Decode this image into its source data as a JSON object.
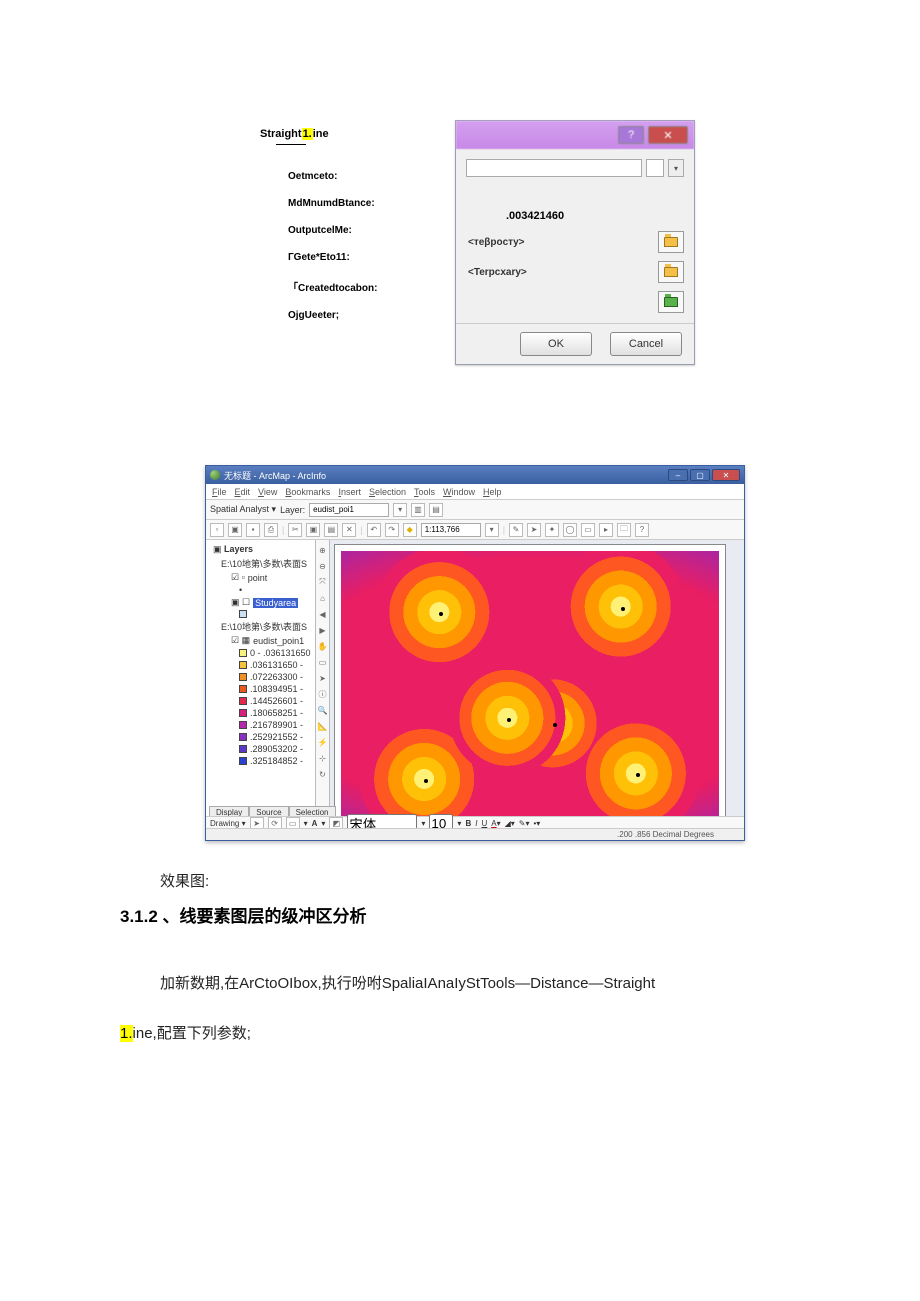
{
  "dialog": {
    "title_part1": "Straight",
    "title_hl": "1.",
    "title_part2": "ine",
    "labels": {
      "l1": "Oetmceto:",
      "l2": "MdMnumdBtance:",
      "l3": "OutputcelMe:",
      "l4": "ГGete*Eto11:",
      "l5": "「Createdtocabon:",
      "l6": "OjgUeeter;"
    },
    "input_placeholder": "",
    "value_cell": ".003421460",
    "opt1": "<тeβpocтy>",
    "opt2": "<Terpcxary>",
    "btn_ok": "OK",
    "btn_cancel": "Cancel",
    "tb_help": "?",
    "tb_close": "✕"
  },
  "arcmap": {
    "title": "无标题 - ArcMap - ArcInfo",
    "menus": [
      "File",
      "Edit",
      "View",
      "Bookmarks",
      "Insert",
      "Selection",
      "Tools",
      "Window",
      "Help"
    ],
    "tb1_label": "Spatial Analyst ▾",
    "tb1_layer_lbl": "Layer:",
    "tb1_layer_val": "eudist_poi1",
    "tb2_scale": "1:113,766",
    "toc": {
      "root": "Layers",
      "grp1": "E:\\10地第\\多数\\表面S",
      "lyr_point": "point",
      "lyr_study_sel": "Studyarea",
      "grp2": "E:\\10地第\\多数\\表面S",
      "lyr_eu": "eudist_poin1",
      "classes": [
        {
          "c": "#f5f17a",
          "t": "0 - .036131650"
        },
        {
          "c": "#f5c23a",
          "t": ".036131650 -"
        },
        {
          "c": "#f09022",
          "t": ".072263300 -"
        },
        {
          "c": "#ea5a1e",
          "t": ".108394951 -"
        },
        {
          "c": "#e22a4e",
          "t": ".144526601 -"
        },
        {
          "c": "#d7207c",
          "t": ".180658251 -"
        },
        {
          "c": "#b828a8",
          "t": ".216789901 -"
        },
        {
          "c": "#8a30c0",
          "t": ".252921552 -"
        },
        {
          "c": "#5a38c8",
          "t": ".289053202 -"
        },
        {
          "c": "#2a40d0",
          "t": ".325184852 -"
        }
      ]
    },
    "toc_tabs": [
      "Display",
      "Source",
      "Selection"
    ],
    "drawing_label": "Drawing ▾",
    "drawing_font": "宋体",
    "status": ".200  .856 Decimal Degrees"
  },
  "text": {
    "result": "效果图:",
    "heading": "3.1.2 、线要素图层的级冲区分析",
    "para1": "加新数期,在ArCtoOIbox,执行吩咐SpaliaIAnaIyStTools—Distance—Straight",
    "para2_hl": "1.",
    "para2_rest": "ine,配置下列参数;"
  }
}
